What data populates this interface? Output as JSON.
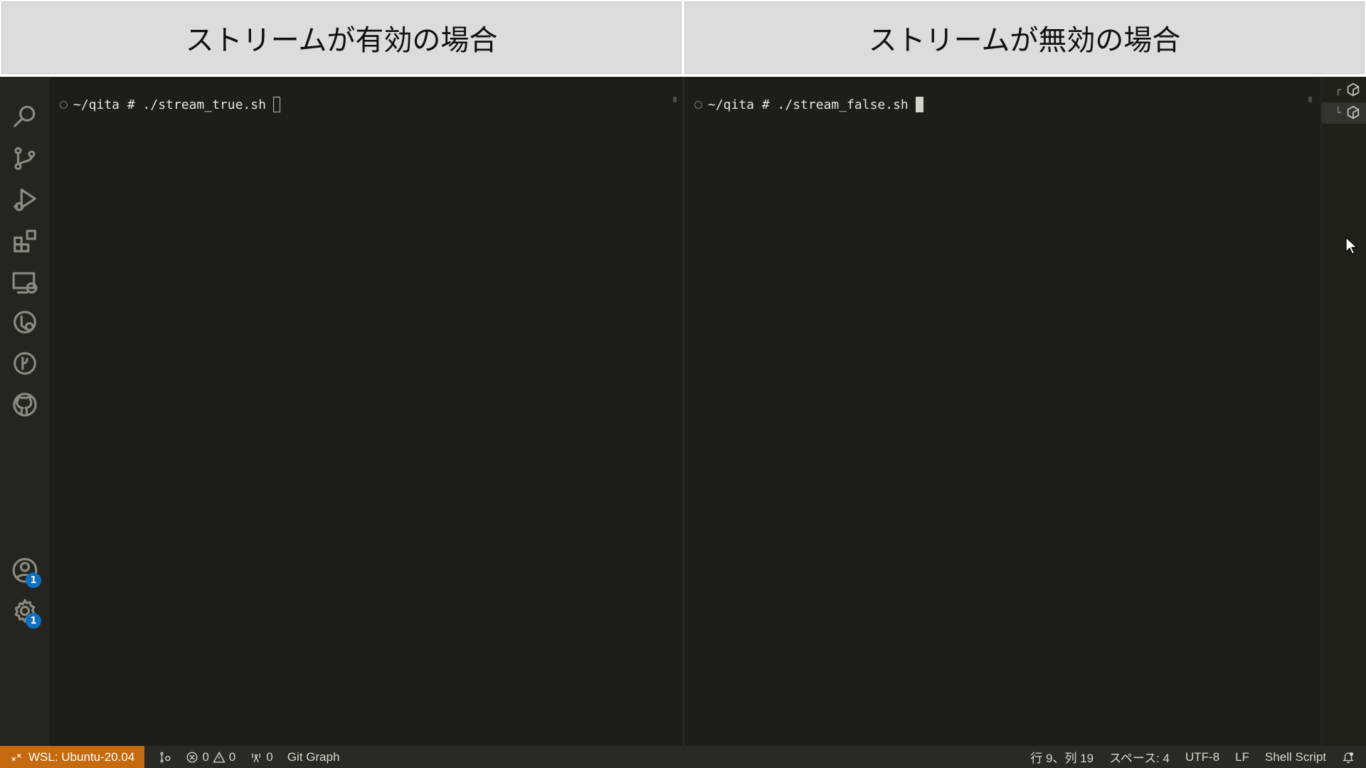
{
  "banners": {
    "left_title": "ストリームが有効の場合",
    "right_title": "ストリームが無効の場合"
  },
  "activity_bar": {
    "items": [
      {
        "icon": "search-icon"
      },
      {
        "icon": "source-control-icon"
      },
      {
        "icon": "run-debug-icon"
      },
      {
        "icon": "extensions-icon"
      },
      {
        "icon": "remote-explorer-icon"
      },
      {
        "icon": "timeline-icon"
      },
      {
        "icon": "git-graph-icon"
      },
      {
        "icon": "github-icon"
      }
    ],
    "accounts": {
      "icon": "account-icon",
      "badge": "1"
    },
    "settings": {
      "icon": "gear-icon",
      "badge": "1"
    }
  },
  "terminal_left": {
    "prompt": "~/qita # ./stream_true.sh"
  },
  "terminal_right": {
    "prompt": "~/qita # ./stream_false.sh"
  },
  "terminal_tabs": [
    {
      "icon": "terminal-tab-icon",
      "corner": "┌"
    },
    {
      "icon": "terminal-tab-icon",
      "corner": "└",
      "active": true
    }
  ],
  "status_bar": {
    "remote": "WSL: Ubuntu-20.04",
    "errors": "0",
    "warnings": "0",
    "ports": "0",
    "git_graph": "Git Graph",
    "line_col": "行 9、列 19",
    "spaces": "スペース: 4",
    "encoding": "UTF-8",
    "eol": "LF",
    "language": "Shell Script"
  },
  "colors": {
    "remote_bg": "#c66a10",
    "badge_bg": "#0e70c0",
    "terminal_bg": "#1e1e18"
  }
}
